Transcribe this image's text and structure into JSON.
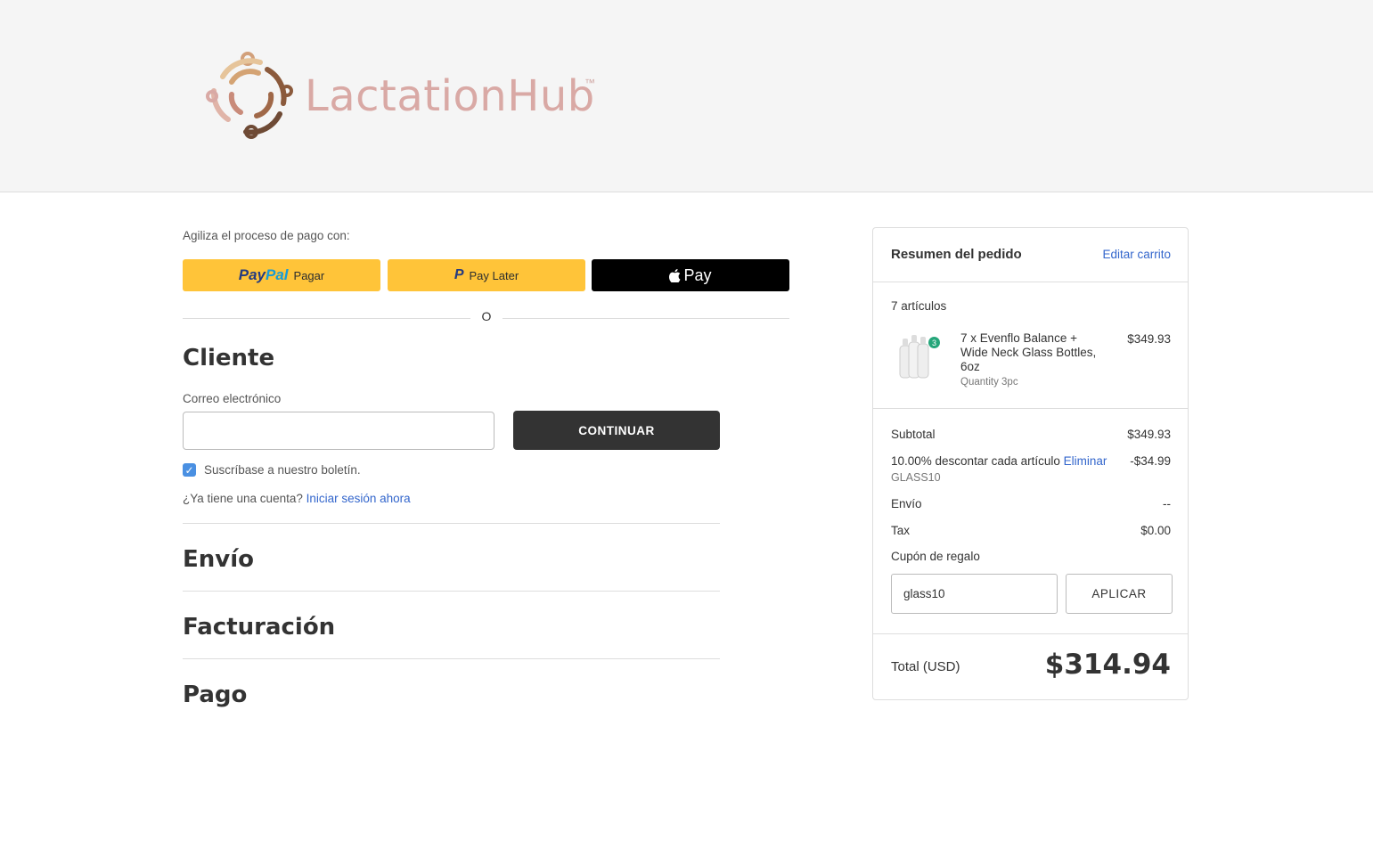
{
  "brand": {
    "name": "LactationHub",
    "tm": "™"
  },
  "express": {
    "label": "Agiliza el proceso de pago con:",
    "paypal_pay": "Pay",
    "paypal_pal": "Pal",
    "paypal_text": "Pagar",
    "paylater_p": "P",
    "paylater_text": "Pay Later",
    "applepay_text": "Pay",
    "or": "O"
  },
  "customer": {
    "title": "Cliente",
    "email_label": "Correo electrónico",
    "email_value": "",
    "continue_label": "CONTINUAR",
    "newsletter_label": "Suscríbase a nuestro boletín.",
    "newsletter_checked": true,
    "account_question": "¿Ya tiene una cuenta?",
    "login_link": "Iniciar sesión ahora"
  },
  "sections": {
    "shipping": "Envío",
    "billing": "Facturación",
    "payment": "Pago"
  },
  "summary": {
    "title": "Resumen del pedido",
    "edit_cart": "Editar carrito",
    "item_count": "7 artículos",
    "item": {
      "name": "7 x Evenflo Balance + Wide Neck Glass Bottles, 6oz",
      "qty": "Quantity 3pc",
      "price": "$349.93",
      "badge": "3"
    },
    "subtotal_label": "Subtotal",
    "subtotal_value": "$349.93",
    "discount_label": "10.00% descontar cada artículo",
    "discount_remove": "Eliminar",
    "discount_value": "-$34.99",
    "discount_code": "GLASS10",
    "shipping_label": "Envío",
    "shipping_value": "--",
    "tax_label": "Tax",
    "tax_value": "$0.00",
    "gift_link": "Cupón de regalo",
    "gift_input_value": "glass10",
    "apply_label": "APLICAR",
    "total_label": "Total (USD)",
    "total_value": "$314.94"
  },
  "colors": {
    "header_bg": "#f5f5f5",
    "paypal_yellow": "#ffc439",
    "link_blue": "#3366cc",
    "dark_button": "#333333",
    "logo_pink": "#d9a9a5"
  }
}
